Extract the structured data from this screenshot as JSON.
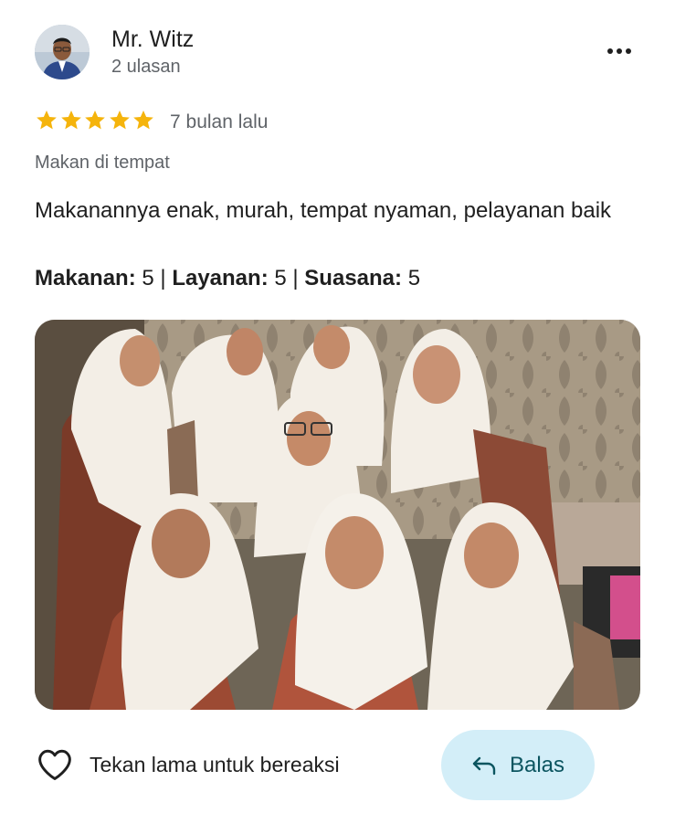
{
  "review": {
    "reviewer_name": "Mr. Witz",
    "review_count": "2 ulasan",
    "rating": 5,
    "rating_max": 5,
    "time_ago": "7 bulan lalu",
    "dine_type": "Makan di tempat",
    "text": "Makanannya enak, murah, tempat nyaman, pelayanan baik",
    "aspect_ratings": [
      {
        "label": "Makanan",
        "value": "5"
      },
      {
        "label": "Layanan",
        "value": "5"
      },
      {
        "label": "Suasana",
        "value": "5"
      }
    ]
  },
  "actions": {
    "react_label": "Tekan lama untuk bereaksi",
    "reply_label": "Balas"
  },
  "icons": {
    "more": "more-horizontal-icon",
    "star": "star-filled-icon",
    "heart": "heart-outline-icon",
    "reply": "reply-arrow-icon"
  },
  "colors": {
    "star": "#f5b40c",
    "secondary_text": "#5f6368",
    "reply_button_bg": "#d3eef8",
    "reply_button_text": "#0b5560"
  }
}
